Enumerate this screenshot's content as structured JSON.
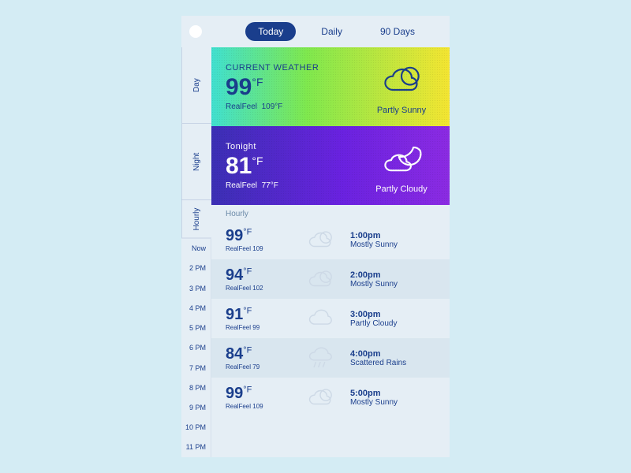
{
  "tabs": {
    "today": "Today",
    "daily": "Daily",
    "ninety": "90 Days"
  },
  "rail": {
    "segments": {
      "day": "Day",
      "night": "Night",
      "hourly": "Hourly"
    },
    "ticks": [
      "Now",
      "2 PM",
      "3 PM",
      "4 PM",
      "5 PM",
      "6 PM",
      "7 PM",
      "8 PM",
      "9 PM",
      "10 PM",
      "11 PM"
    ]
  },
  "current": {
    "label": "CURRENT WEATHER",
    "temp": "99",
    "unit": "°F",
    "realfeel_label": "RealFeel",
    "realfeel": "109°F",
    "condition": "Partly Sunny"
  },
  "tonight": {
    "label": "Tonight",
    "temp": "81",
    "unit": "°F",
    "realfeel_label": "RealFeel",
    "realfeel": "77°F",
    "condition": "Partly Cloudy"
  },
  "hourly": {
    "label": "Hourly",
    "rows": [
      {
        "temp": "99",
        "unit": "°F",
        "rf": "RealFeel 109",
        "time": "1:00pm",
        "cond": "Mostly Sunny"
      },
      {
        "temp": "94",
        "unit": "°F",
        "rf": "RealFeel 102",
        "time": "2:00pm",
        "cond": "Mostly Sunny"
      },
      {
        "temp": "91",
        "unit": "°F",
        "rf": "RealFeel 99",
        "time": "3:00pm",
        "cond": "Partly Cloudy"
      },
      {
        "temp": "84",
        "unit": "°F",
        "rf": "RealFeel 79",
        "time": "4:00pm",
        "cond": "Scattered Rains"
      },
      {
        "temp": "99",
        "unit": "°F",
        "rf": "RealFeel 109",
        "time": "5:00pm",
        "cond": "Mostly Sunny"
      }
    ]
  }
}
